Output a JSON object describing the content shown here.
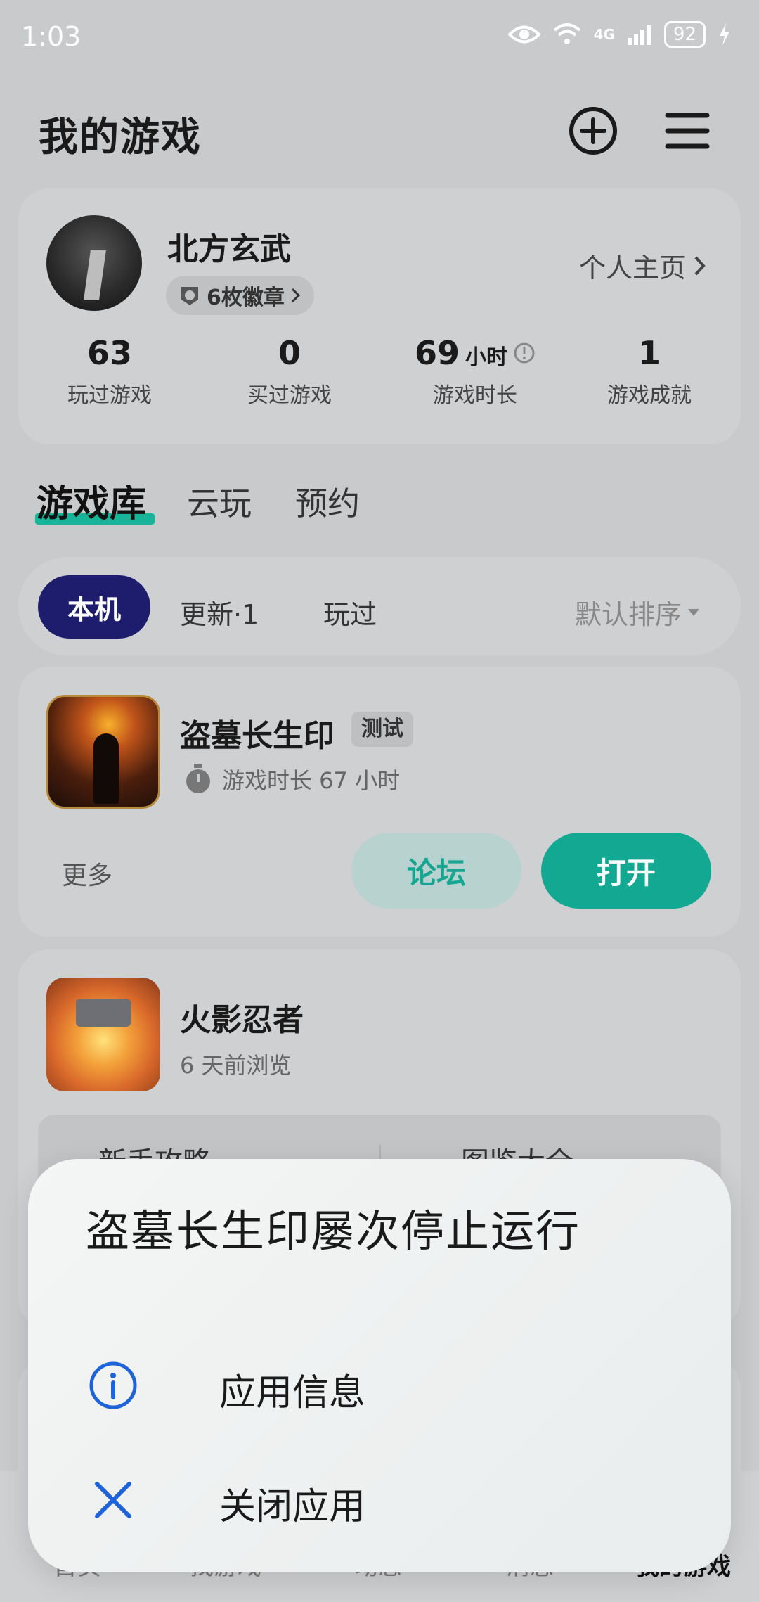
{
  "status_bar": {
    "time": "1:03",
    "network": "4G",
    "battery": "92"
  },
  "header": {
    "title": "我的游戏",
    "add_icon": "plus-circle-icon",
    "menu_icon": "hamburger-menu-icon"
  },
  "profile": {
    "name": "北方玄武",
    "badges": "6枚徽章",
    "homepage": "个人主页",
    "stats": [
      {
        "value": "63",
        "unit": "",
        "label": "玩过游戏"
      },
      {
        "value": "0",
        "unit": "",
        "label": "买过游戏"
      },
      {
        "value": "69",
        "unit": "小时",
        "label": "游戏时长"
      },
      {
        "value": "1",
        "unit": "",
        "label": "游戏成就"
      }
    ]
  },
  "tabs": [
    "游戏库",
    "云玩",
    "预约"
  ],
  "filters": {
    "chips": [
      "本机",
      "更新·1",
      "玩过"
    ],
    "sort": "默认排序"
  },
  "games": [
    {
      "name": "盗墓长生印",
      "tag": "测试",
      "subtitle": "游戏时长 67 小时",
      "more": "更多",
      "forum": "论坛",
      "open": "打开"
    },
    {
      "name": "火影忍者",
      "subtitle": "6 天前浏览",
      "guides": [
        "新手攻略",
        "图鉴大全"
      ]
    }
  ],
  "bottom_nav": [
    "首页",
    "找游戏",
    "动态",
    "消息",
    "我的游戏"
  ],
  "dialog": {
    "title": "盗墓长生印屡次停止运行",
    "actions": [
      {
        "label": "应用信息",
        "icon": "info-icon"
      },
      {
        "label": "关闭应用",
        "icon": "close-icon"
      }
    ]
  },
  "colors": {
    "accent": "#12a891",
    "chip_active": "#1e1d6d",
    "dialog_icon": "#1e63d8"
  }
}
